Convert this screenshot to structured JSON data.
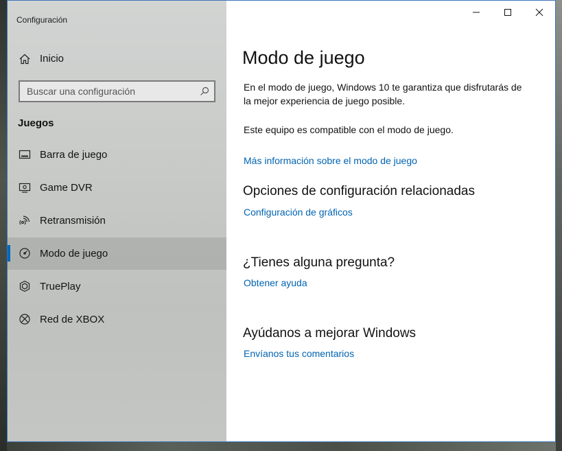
{
  "window": {
    "app_title": "Configuración"
  },
  "sidebar": {
    "home_label": "Inicio",
    "search_placeholder": "Buscar una configuración",
    "section_header": "Juegos",
    "items": [
      {
        "label": "Barra de juego",
        "icon": "game-bar-icon"
      },
      {
        "label": "Game DVR",
        "icon": "game-dvr-icon"
      },
      {
        "label": "Retransmisión",
        "icon": "broadcasting-icon"
      },
      {
        "label": "Modo de juego",
        "icon": "game-mode-icon",
        "selected": true
      },
      {
        "label": "TruePlay",
        "icon": "trueplay-icon"
      },
      {
        "label": "Red de XBOX",
        "icon": "xbox-icon"
      }
    ]
  },
  "main": {
    "title": "Modo de juego",
    "description": "En el modo de juego, Windows 10 te garantiza que disfrutarás de la mejor experiencia de juego posible.",
    "compatibility": "Este equipo es compatible con el modo de juego.",
    "more_info_link": "Más información sobre el modo de juego",
    "related_header": "Opciones de configuración relacionadas",
    "graphics_link": "Configuración de gráficos",
    "question_header": "¿Tienes alguna pregunta?",
    "help_link": "Obtener ayuda",
    "improve_header": "Ayúdanos a mejorar Windows",
    "feedback_link": "Envíanos tus comentarios"
  },
  "colors": {
    "accent": "#0067c0",
    "link": "#0063b1",
    "window_border": "#3b74b8"
  }
}
